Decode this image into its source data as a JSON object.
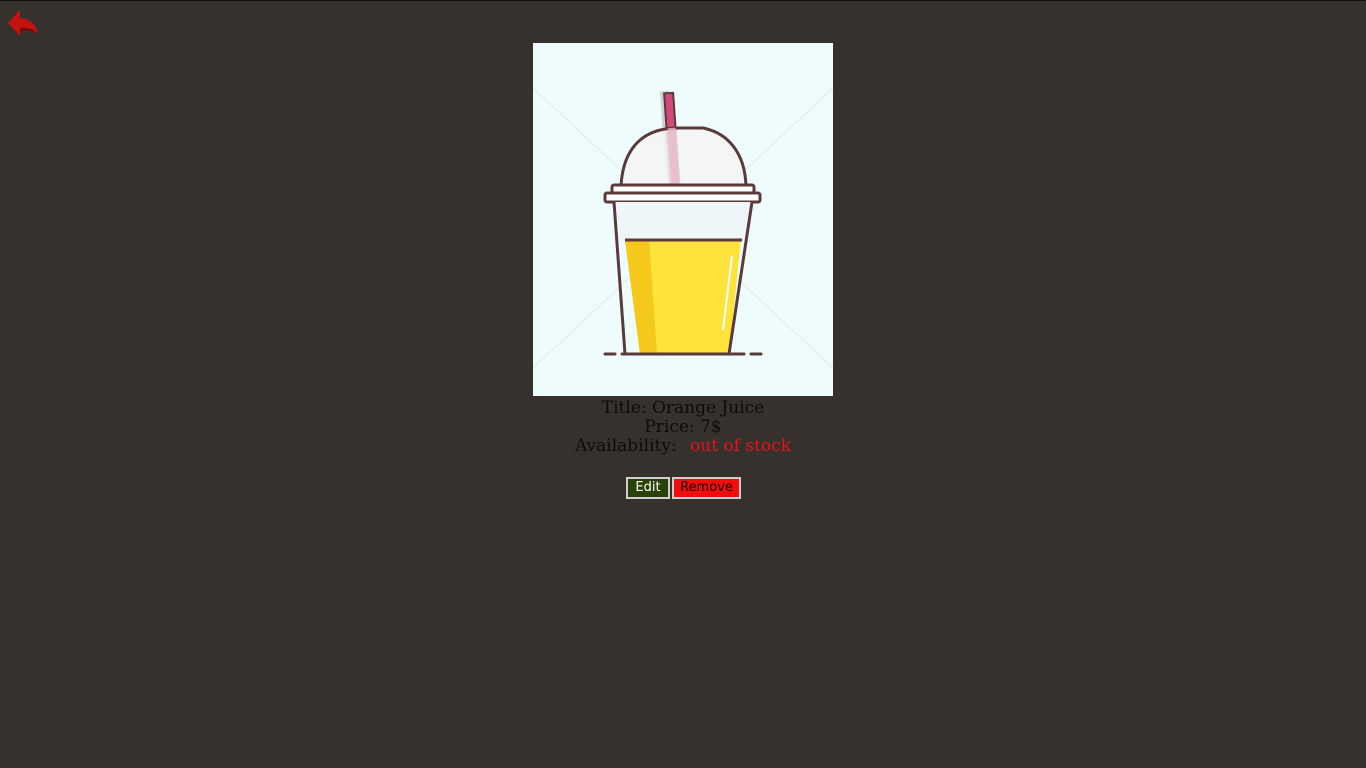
{
  "nav": {
    "back_icon": "back-arrow-icon"
  },
  "product": {
    "image_icon": "juice-cup-image",
    "title_label": "Title:",
    "title_value": "Orange Juice",
    "price_label": "Price:",
    "price_value": "7$",
    "availability_label": "Availability:",
    "availability_value": "out of stock"
  },
  "actions": {
    "edit_label": "Edit",
    "remove_label": "Remove"
  },
  "colors": {
    "background": "#36312d",
    "out_of_stock": "#e8121b",
    "edit_button": "#2a4208",
    "remove_button": "#f20d0d"
  }
}
